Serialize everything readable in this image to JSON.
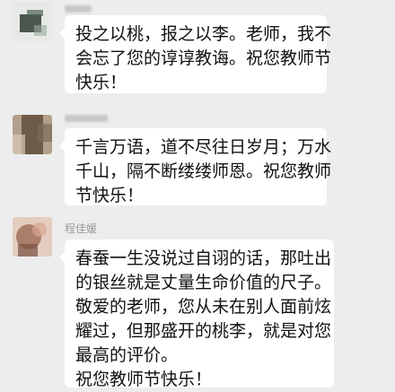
{
  "messages": [
    {
      "sender": "",
      "lines": [
        "投之以桃，报之以李。老师，我不",
        "会忘了您的谆谆教诲。祝您教师节",
        "快乐！"
      ]
    },
    {
      "sender": "",
      "lines": [
        "千言万语，道不尽往日岁月；万水",
        "千山，隔不断缕缕师恩。祝您教师",
        "节快乐！"
      ]
    },
    {
      "sender": "程佳媛",
      "lines": [
        "春蚕一生没说过自诩的话，那吐出",
        "的银丝就是丈量生命价值的尺子。",
        "敬爱的老师，您从未在别人面前炫",
        "耀过，但那盛开的桃李，就是对您",
        "最高的评价。",
        "祝您教师节快乐！"
      ]
    }
  ],
  "colors": {
    "background": "#ededed",
    "bubble": "#ffffff",
    "text": "#111111",
    "sender_name": "#9a9a9a"
  }
}
